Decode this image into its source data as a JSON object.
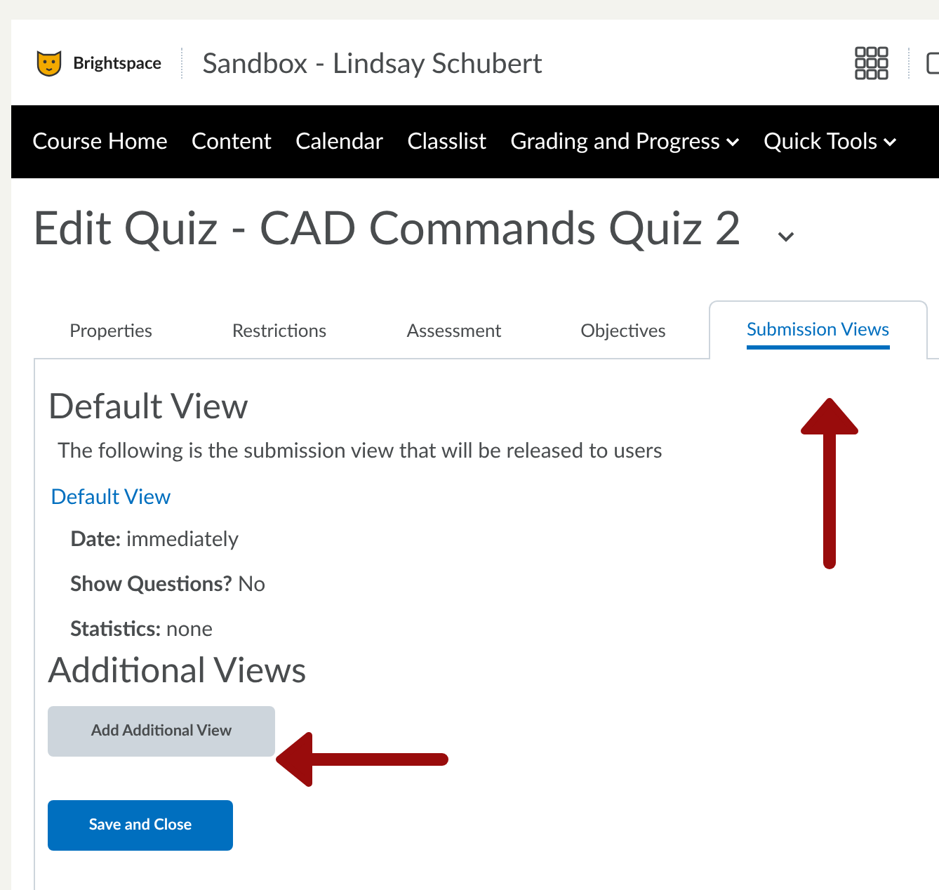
{
  "header": {
    "brand": "Brightspace",
    "course_title": "Sandbox - Lindsay Schubert"
  },
  "nav": [
    {
      "label": "Course Home",
      "dropdown": false
    },
    {
      "label": "Content",
      "dropdown": false
    },
    {
      "label": "Calendar",
      "dropdown": false
    },
    {
      "label": "Classlist",
      "dropdown": false
    },
    {
      "label": "Grading and Progress",
      "dropdown": true
    },
    {
      "label": "Quick Tools",
      "dropdown": true
    }
  ],
  "page_title": "Edit Quiz - CAD Commands Quiz 2",
  "tabs": [
    {
      "label": "Properties",
      "selected": false
    },
    {
      "label": "Restrictions",
      "selected": false
    },
    {
      "label": "Assessment",
      "selected": false
    },
    {
      "label": "Objectives",
      "selected": false
    },
    {
      "label": "Submission Views",
      "selected": true
    }
  ],
  "default_view": {
    "heading": "Default View",
    "description": "The following is the submission view that will be released to users",
    "link": "Default View",
    "details": [
      {
        "label": "Date:",
        "value": "immediately"
      },
      {
        "label": "Show Questions?",
        "value": "No"
      },
      {
        "label": "Statistics:",
        "value": "none"
      }
    ]
  },
  "additional_views": {
    "heading": "Additional Views",
    "button": "Add Additional View"
  },
  "save_button": "Save and Close"
}
